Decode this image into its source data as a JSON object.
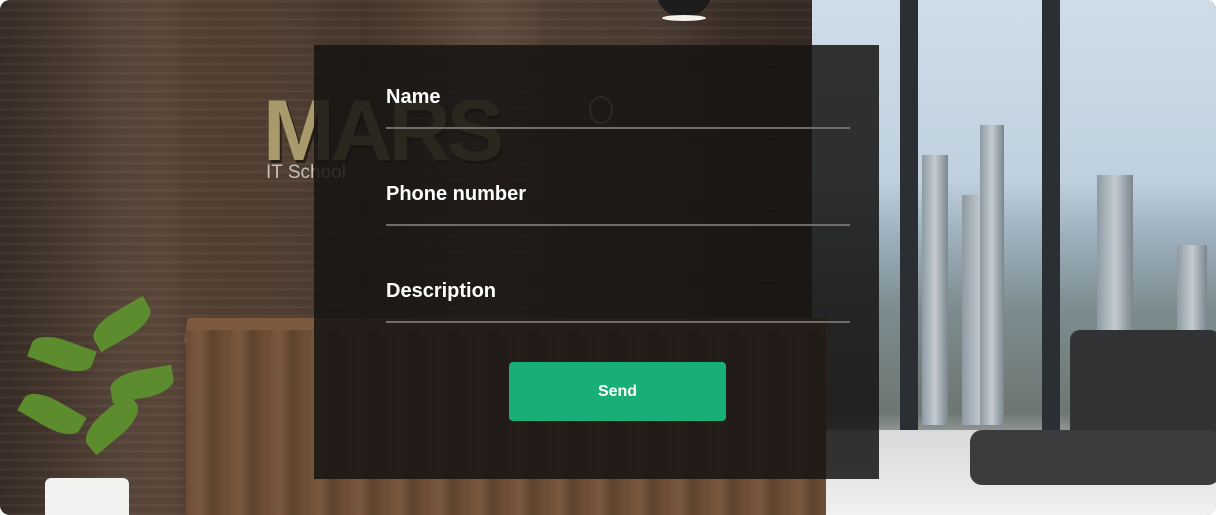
{
  "background": {
    "logo_text": "MARS",
    "logo_subtext": "IT School"
  },
  "form": {
    "name_label": "Name",
    "phone_label": "Phone number",
    "description_label": "Description",
    "send_label": "Send"
  },
  "colors": {
    "send_button": "#19ad78",
    "overlay": "#161413",
    "label_text": "#ffffff"
  }
}
